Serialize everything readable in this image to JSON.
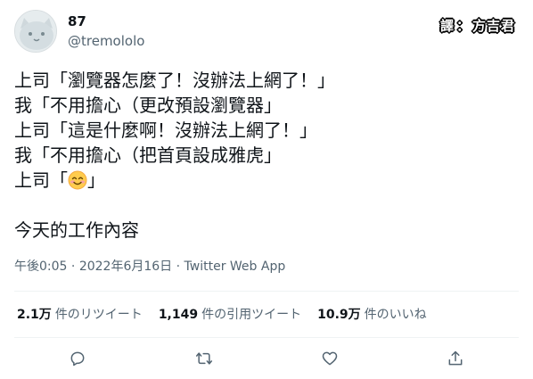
{
  "author": {
    "display_name": "87",
    "handle": "@tremololo"
  },
  "translator_badge": {
    "label": "譯",
    "separator": "：",
    "name": "方吉君"
  },
  "tweet": {
    "lines": [
      "上司「瀏覽器怎麼了！沒辦法上網了！」",
      "我「不用擔心（更改預設瀏覽器」",
      "上司「這是什麼啊！沒辦法上網了！」",
      "我「不用擔心（把首頁設成雅虎」"
    ],
    "last_line_prefix": "上司「",
    "last_line_suffix": "」",
    "emoji": "smiling-face-with-smiling-eyes",
    "closing_line": "今天的工作內容"
  },
  "meta": {
    "time": "午後0:05",
    "sep": " · ",
    "date": "2022年6月16日",
    "source": "Twitter Web App"
  },
  "stats": {
    "retweets_count": "2.1万",
    "retweets_label": "件のリツイート",
    "quotes_count": "1,149",
    "quotes_label": "件の引用ツイート",
    "likes_count": "10.9万",
    "likes_label": "件のいいね"
  },
  "actions": {
    "icons": [
      "reply-icon",
      "retweet-icon",
      "like-icon",
      "share-icon"
    ]
  },
  "colors": {
    "text_primary": "#0f1419",
    "text_secondary": "#536471",
    "divider": "#eff3f4"
  }
}
